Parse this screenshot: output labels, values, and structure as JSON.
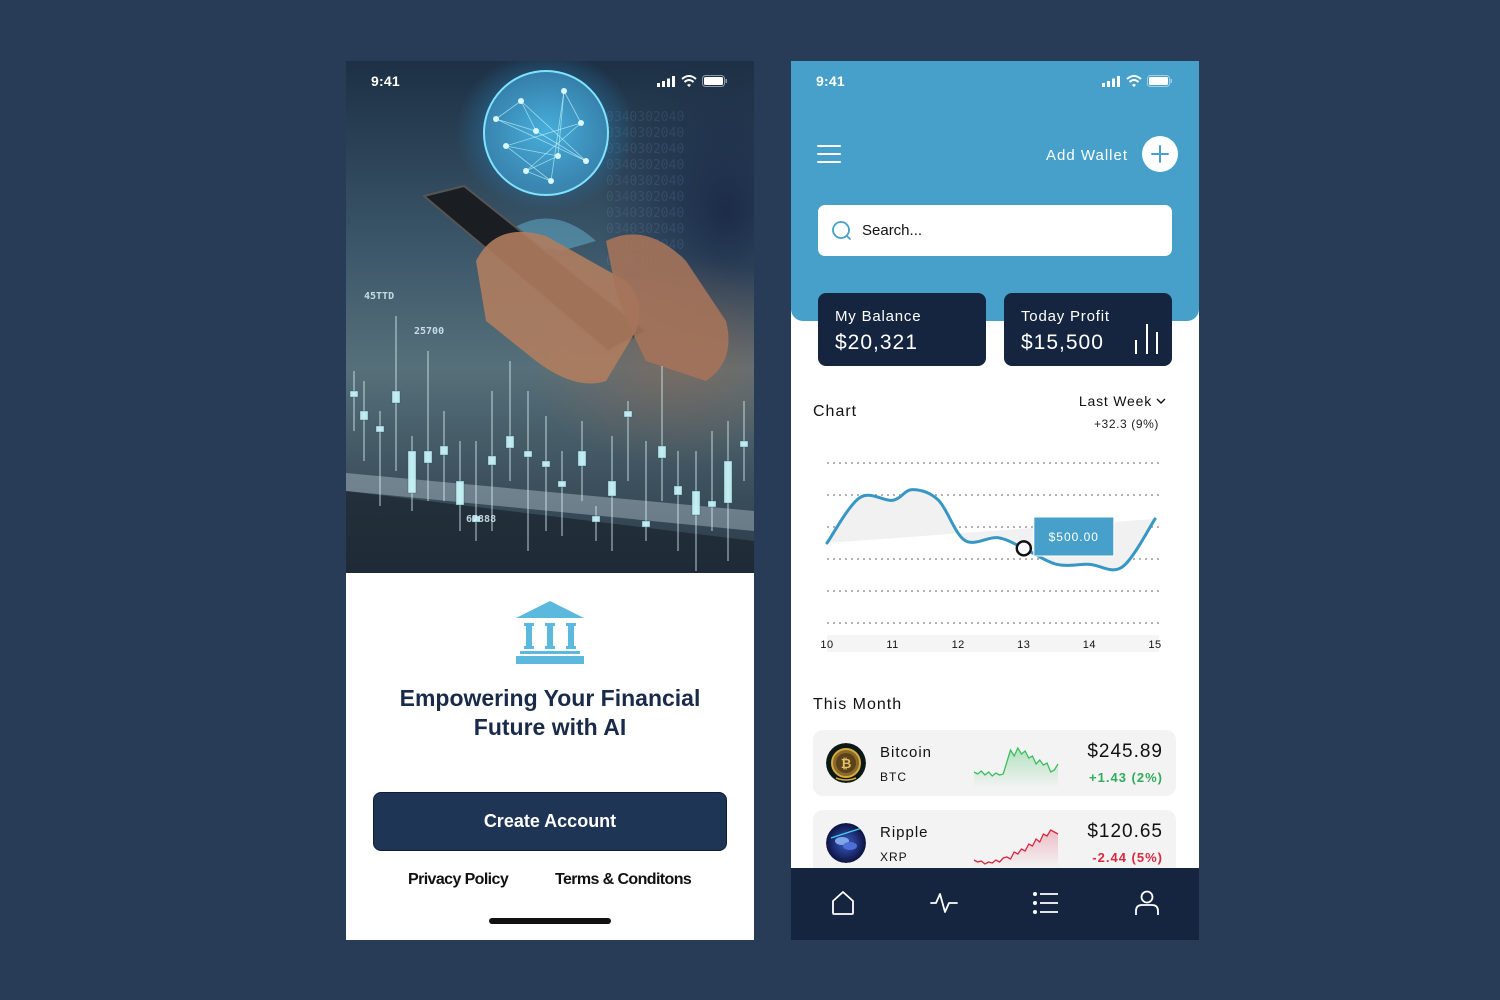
{
  "colors": {
    "page_bg": "#283b57",
    "navy": "#15253f",
    "button_navy": "#1f3556",
    "accent_blue": "#46a0c9",
    "positive": "#2fae5b",
    "negative": "#d6293f",
    "icon_blue": "#5bb9de"
  },
  "onboarding": {
    "status_time": "9:41",
    "hero_numbers": [
      "45TTD",
      "25700",
      "67888"
    ],
    "headline": "Empowering Your Financial Future with AI",
    "create_account_label": "Create Account",
    "privacy_label": "Privacy Policy",
    "terms_label": "Terms & Conditons",
    "icons": {
      "brand": "bank-icon"
    }
  },
  "dashboard": {
    "status_time": "9:41",
    "add_wallet_label": "Add Wallet",
    "search_placeholder": "Search...",
    "balance": {
      "label": "My Balance",
      "value": "$20,321"
    },
    "profit": {
      "label": "Today Profit",
      "value": "$15,500"
    },
    "chart_title": "Chart",
    "period": "Last Week",
    "period_change": "+32.3 (9%)",
    "section_title": "This Month",
    "coins": [
      {
        "name": "Bitcoin",
        "symbol": "BTC",
        "price": "$245.89",
        "change": "+1.43 (2%)",
        "trend": "up"
      },
      {
        "name": "Ripple",
        "symbol": "XRP",
        "price": "$120.65",
        "change": "-2.44 (5%)",
        "trend": "down"
      }
    ],
    "nav": [
      "home",
      "activity",
      "list",
      "profile"
    ]
  },
  "chart_data": {
    "type": "line",
    "title": "Chart",
    "x": [
      10,
      10.5,
      11,
      11.3,
      11.7,
      12.1,
      12.6,
      13,
      13.5,
      14,
      14.5,
      15
    ],
    "tick_labels": [
      "10",
      "11",
      "12",
      "13",
      "14",
      "15"
    ],
    "y": [
      3.0,
      4.7,
      4.6,
      5.0,
      4.6,
      3.1,
      3.2,
      2.8,
      2.2,
      2.2,
      2.1,
      3.9
    ],
    "ylim": [
      0,
      6
    ],
    "grid": true,
    "highlight": {
      "x": 13,
      "label": "$500.00"
    },
    "xlabel": "",
    "ylabel": ""
  }
}
